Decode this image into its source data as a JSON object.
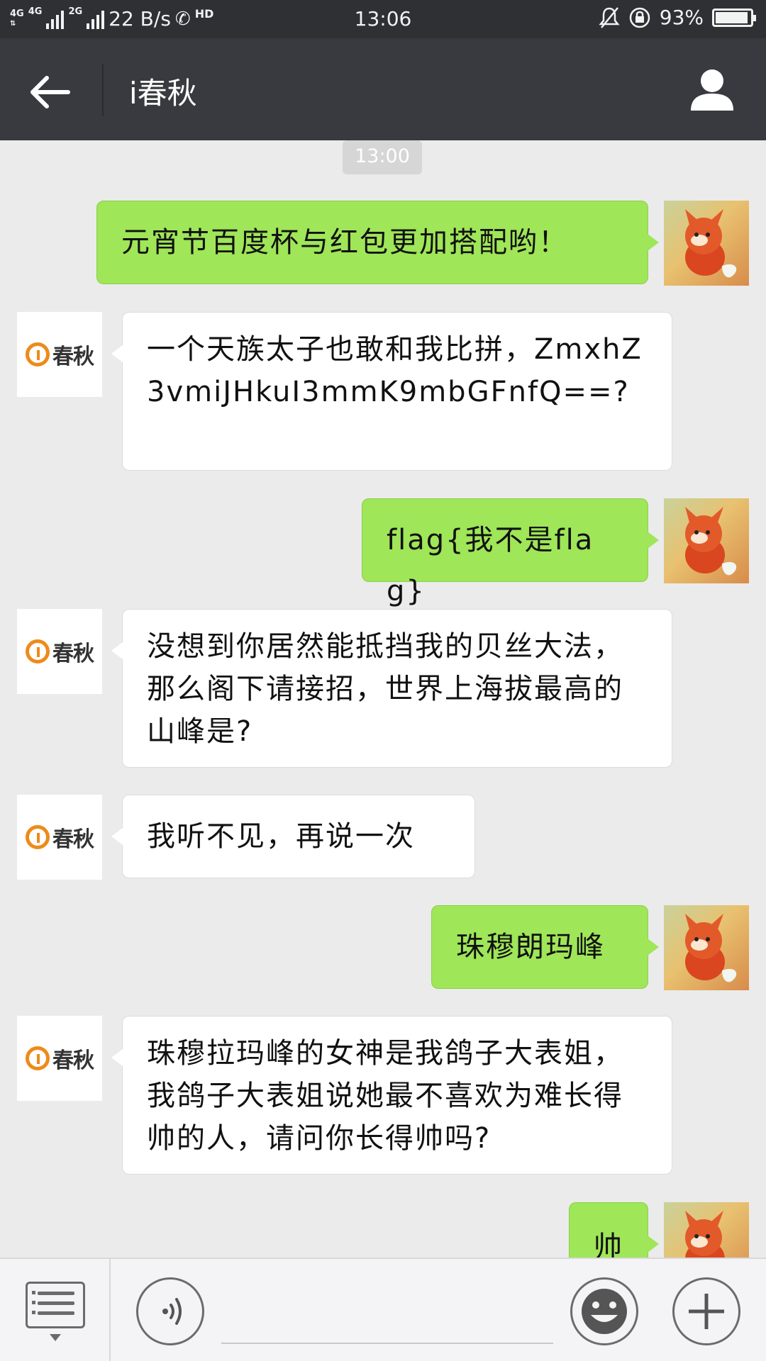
{
  "status_bar": {
    "network_1": "4G",
    "network_2": "4G",
    "network_3": "2G",
    "speed": "22 B/s",
    "hd": "HD",
    "time": "13:06",
    "battery_percent": "93%",
    "battery_level": 0.93
  },
  "header": {
    "title": "i春秋"
  },
  "chat": {
    "timestamp": "13:00",
    "messages": [
      {
        "sender": "me",
        "text": "元宵节百度杯与红包更加搭配哟！"
      },
      {
        "sender": "them",
        "text": "一个天族太子也敢和我比拼，ZmxhZ3vmiJHkuI3mmK9mbGFnfQ==?"
      },
      {
        "sender": "me",
        "text": "flag{我不是flag}"
      },
      {
        "sender": "them",
        "text": "没想到你居然能抵挡我的贝丝大法，那么阁下请接招，世界上海拔最高的山峰是?"
      },
      {
        "sender": "them",
        "text": "我听不见，再说一次"
      },
      {
        "sender": "me",
        "text": "珠穆朗玛峰"
      },
      {
        "sender": "them",
        "text": "珠穆拉玛峰的女神是我鸽子大表姐，我鸽子大表姐说她最不喜欢为难长得帅的人，请问你长得帅吗?"
      },
      {
        "sender": "me",
        "text": "帅"
      }
    ],
    "contact_logo_text": "春秋"
  },
  "icons": {
    "back": "back-arrow-icon",
    "profile": "person-icon",
    "menu": "list-menu-icon",
    "voice": "voice-icon",
    "emoji": "emoji-icon",
    "plus": "plus-icon"
  },
  "colors": {
    "status_bar_bg": "#2f3033",
    "title_bar_bg": "#393a3f",
    "chat_bg": "#ebebeb",
    "my_bubble": "#9fe658",
    "their_bubble": "#ffffff",
    "brand_orange": "#ee8a1a"
  }
}
